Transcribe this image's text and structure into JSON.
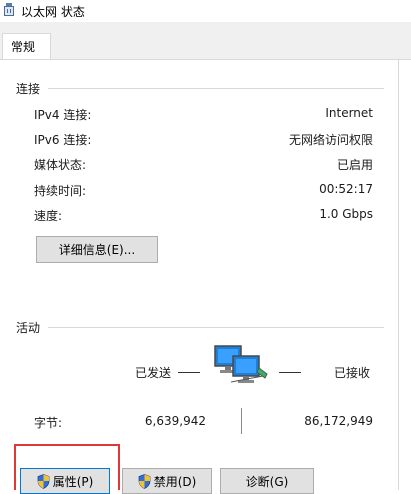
{
  "window": {
    "title": "以太网 状态"
  },
  "tabs": [
    {
      "label": "常规"
    }
  ],
  "connection": {
    "group_label": "连接",
    "rows": [
      {
        "label": "IPv4 连接:",
        "value": "Internet"
      },
      {
        "label": "IPv6 连接:",
        "value": "无网络访问权限"
      },
      {
        "label": "媒体状态:",
        "value": "已启用"
      },
      {
        "label": "持续时间:",
        "value": "00:52:17"
      },
      {
        "label": "速度:",
        "value": "1.0 Gbps"
      }
    ],
    "details_button": "详细信息(E)..."
  },
  "activity": {
    "group_label": "活动",
    "sent_label": "已发送",
    "received_label": "已接收",
    "bytes_label": "字节:",
    "bytes_sent": "6,639,942",
    "bytes_received": "86,172,949"
  },
  "buttons": {
    "properties": "属性(P)",
    "disable": "禁用(D)",
    "diagnose": "诊断(G)"
  },
  "colors": {
    "focus_border": "#0078d7",
    "highlight": "#e03838",
    "button_bg": "#e1e1e1"
  },
  "icons": {
    "window": "network-adapter-icon",
    "activity": "network-computer-icon",
    "uac": "uac-shield-icon"
  }
}
